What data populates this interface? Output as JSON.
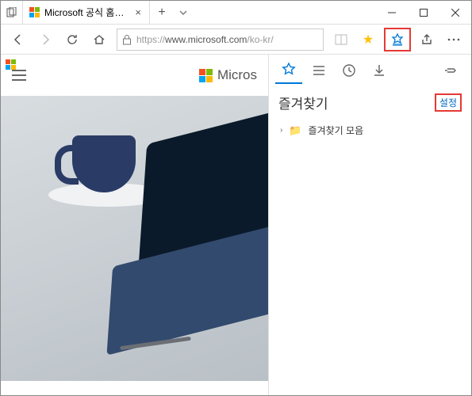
{
  "tab": {
    "title": "Microsoft 공식 홈페이지"
  },
  "address": {
    "protocol": "https://",
    "host": "www.microsoft.com",
    "path": "/ko-kr/"
  },
  "page": {
    "brand": "Microsoft",
    "brand_visible": "Micros"
  },
  "hub": {
    "title": "즐겨찾기",
    "settings_label": "설정",
    "folder_label": "즐겨찾기 모음"
  }
}
